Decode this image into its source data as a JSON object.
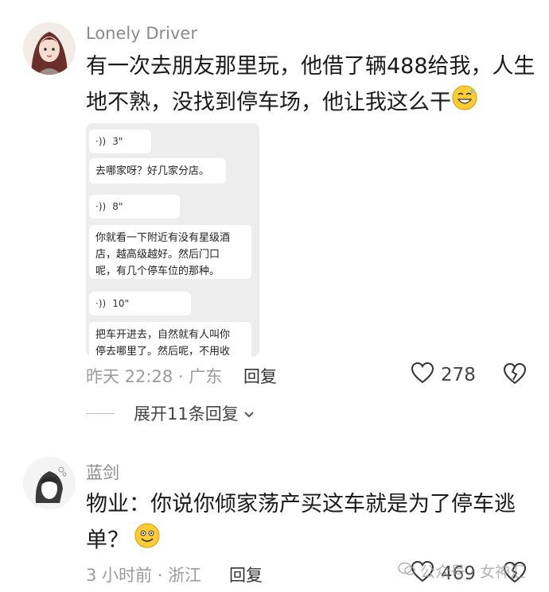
{
  "comment1": {
    "username": "Lonely Driver",
    "text_line1": "有一次去朋友那里玩，他借了辆488给我，人生",
    "text_line2": "地不熟，没找到停车场，他让我这么干",
    "chat": {
      "voice1": "3\"",
      "msg1": "去哪家呀？好几家分店。",
      "voice2": "8\"",
      "msg2_line1": "你就看一下附近有没有星级酒",
      "msg2_line2": "店，越高级越好。然后门口",
      "msg2_line3": "呢，有几个停车位的那种。",
      "voice3": "10\"",
      "msg3_line1": "把车开进去，自然就有人叫你",
      "msg3_line2": "停去哪里了。然后呢，不用收"
    },
    "time_location": "昨天 22:28 · 广东",
    "reply_label": "回复",
    "likes": "278",
    "icons": {
      "emoji": "grinning-sweat-emoji",
      "like": "heart-outline-icon",
      "dislike": "broken-heart-icon"
    }
  },
  "expand_replies": "展开11条回复",
  "comment2": {
    "username": "蓝剑",
    "text_line1": "物业：你说你倾家荡产买这车就是为了停车逃",
    "text_line2": "单？",
    "time_location": "3 小时前 · 浙江",
    "reply_label": "回复",
    "likes": "469",
    "icons": {
      "emoji": "smiling-emoji",
      "like": "heart-outline-icon",
      "dislike": "broken-heart-icon"
    }
  },
  "watermark": "公众号 · 女神汇"
}
